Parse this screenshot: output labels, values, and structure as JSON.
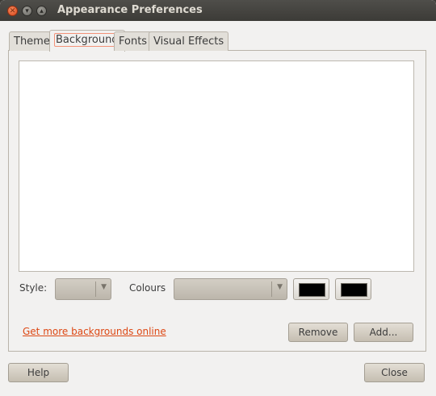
{
  "window": {
    "title": "Appearance Preferences",
    "controls": [
      "close-icon",
      "minimize-icon",
      "maximize-icon"
    ]
  },
  "tabs": [
    {
      "label": "Theme",
      "active": false
    },
    {
      "label": "Background",
      "active": true
    },
    {
      "label": "Fonts",
      "active": false
    },
    {
      "label": "Visual Effects",
      "active": false
    }
  ],
  "background_tab": {
    "style_label": "Style:",
    "style_value": "",
    "colours_label": "Colours",
    "colours_value": "",
    "primary_colour": "#000000",
    "secondary_colour": "#000000",
    "get_more_link": "Get more backgrounds online",
    "remove_button": "Remove",
    "add_button": "Add..."
  },
  "footer": {
    "help_button": "Help",
    "close_button": "Close"
  },
  "colors": {
    "accent": "#dd4814",
    "titlebar": "#3c3b37",
    "window_bg": "#f2f1f0"
  }
}
